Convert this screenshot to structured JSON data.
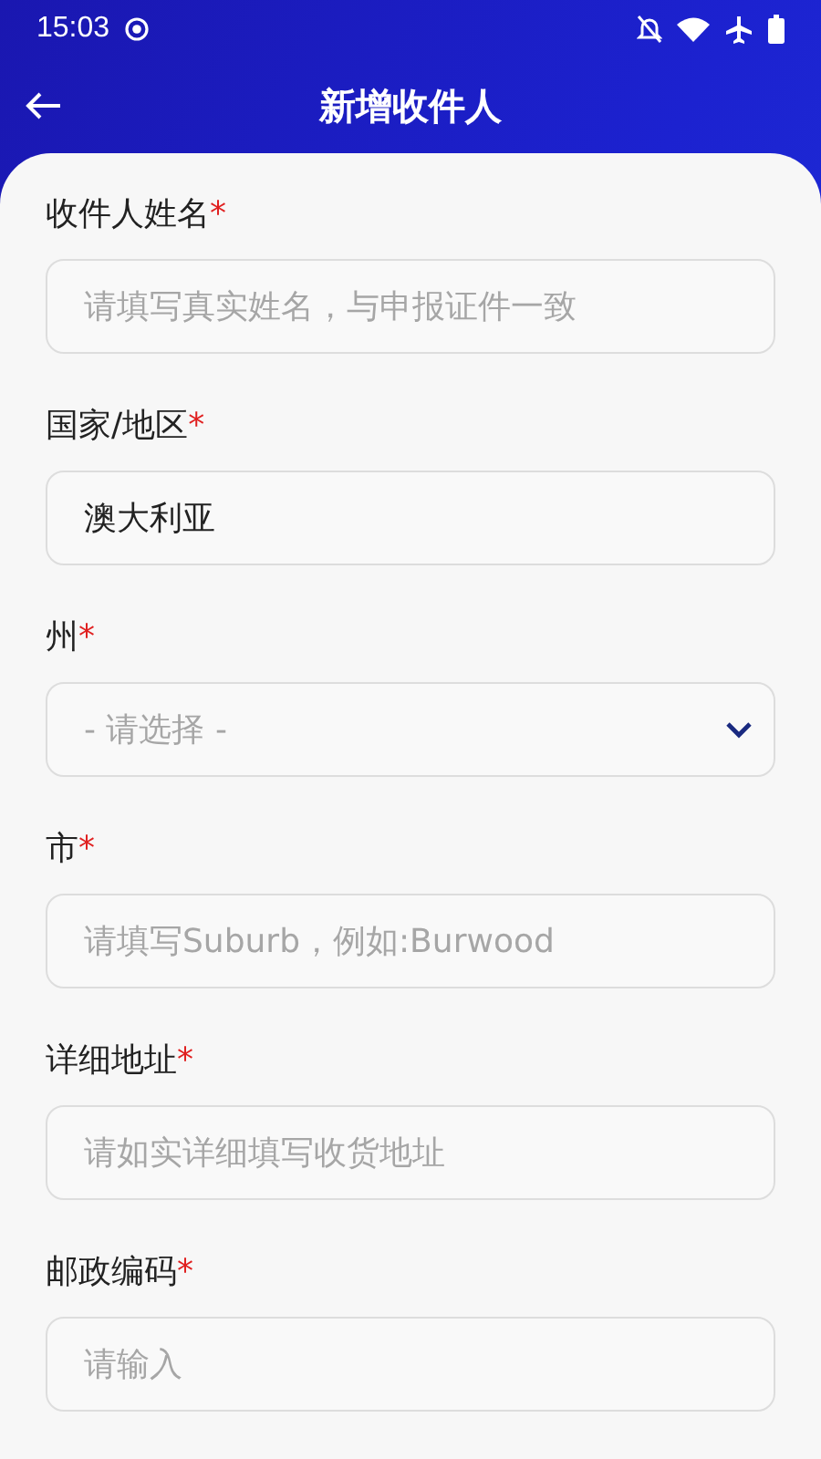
{
  "status_bar": {
    "time": "15:03"
  },
  "header": {
    "title": "新增收件人"
  },
  "fields": [
    {
      "label": "收件人姓名",
      "required_mark": "*",
      "kind": "text",
      "placeholder": "请填写真实姓名，与申报证件一致"
    },
    {
      "label": "国家/地区",
      "required_mark": "*",
      "kind": "text",
      "value": "澳大利亚"
    },
    {
      "label": "州",
      "required_mark": "*",
      "kind": "select",
      "placeholder": "- 请选择 -"
    },
    {
      "label": "市",
      "required_mark": "*",
      "kind": "text",
      "placeholder": "请填写Suburb，例如:Burwood"
    },
    {
      "label": "详细地址",
      "required_mark": "*",
      "kind": "text",
      "placeholder": "请如实详细填写收货地址"
    },
    {
      "label": "邮政编码",
      "required_mark": "*",
      "kind": "text",
      "placeholder": "请输入"
    }
  ]
}
